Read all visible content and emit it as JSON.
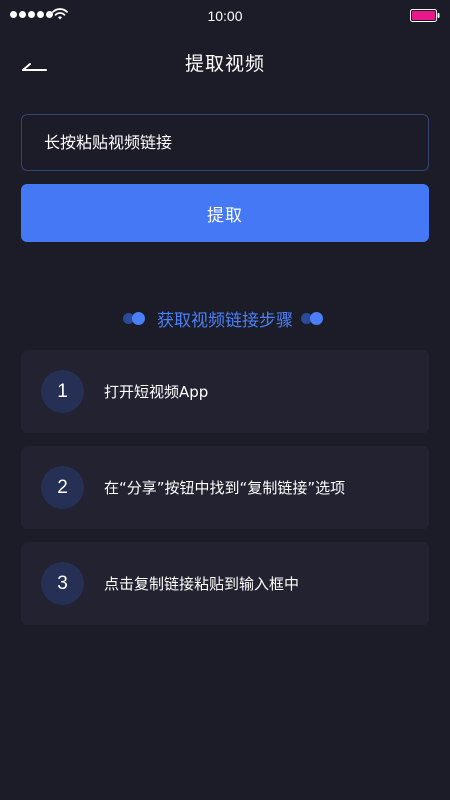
{
  "status_bar": {
    "time": "10:00",
    "battery_color": "#e8198b"
  },
  "header": {
    "title": "提取视频",
    "back_icon": "back-arrow-icon"
  },
  "link_input": {
    "placeholder": "长按粘贴视频链接",
    "value": ""
  },
  "extract_button": {
    "label": "提取"
  },
  "steps_section": {
    "title": "获取视频链接步骤",
    "steps": [
      {
        "number": "1",
        "text": "打开短视频App"
      },
      {
        "number": "2",
        "text": "在“分享”按钮中找到“复制链接”选项"
      },
      {
        "number": "3",
        "text": "点击复制链接粘贴到输入框中"
      }
    ]
  },
  "colors": {
    "background": "#1c1c28",
    "card": "#222231",
    "accent": "#4478f5",
    "number_circle": "#263055"
  }
}
